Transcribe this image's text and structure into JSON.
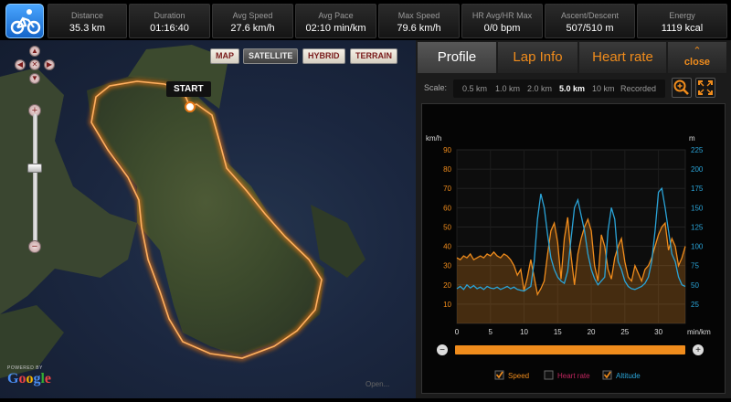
{
  "stats": [
    {
      "label": "Distance",
      "value": "35.3 km"
    },
    {
      "label": "Duration",
      "value": "01:16:40"
    },
    {
      "label": "Avg Speed",
      "value": "27.6 km/h"
    },
    {
      "label": "Avg Pace",
      "value": "02:10 min/km"
    },
    {
      "label": "Max Speed",
      "value": "79.6 km/h"
    },
    {
      "label": "HR Avg/HR Max",
      "value": "0/0 bpm"
    },
    {
      "label": "Ascent/Descent",
      "value": "507/510 m"
    },
    {
      "label": "Energy",
      "value": "1119 kcal"
    }
  ],
  "map": {
    "types": [
      "MAP",
      "SATELLITE",
      "HYBRID",
      "TERRAIN"
    ],
    "active_type": "SATELLITE",
    "start_label": "START",
    "nav": {
      "up": "▲",
      "down": "▼",
      "left": "◀",
      "right": "▶",
      "center": "✕"
    },
    "zoom": {
      "plus": "+",
      "minus": "−"
    },
    "attribution": {
      "powered_by": "POWERED BY",
      "logo": "Google"
    },
    "credit": "Open..."
  },
  "panel": {
    "tabs": [
      "Profile",
      "Lap Info",
      "Heart rate"
    ],
    "active_tab": "Profile",
    "close": {
      "chevron": "⌃",
      "label": "close"
    },
    "scale": {
      "label": "Scale:",
      "options": [
        "0.5 km",
        "1.0 km",
        "2.0 km",
        "5.0 km",
        "10 km",
        "Recorded"
      ],
      "selected": "5.0 km"
    },
    "icons": [
      "zoom-in-icon",
      "expand-icon"
    ]
  },
  "chart_data": {
    "type": "line",
    "x_unit": "min/km",
    "left_unit": "km/h",
    "right_unit": "m",
    "x_range": [
      0,
      34
    ],
    "x_ticks": [
      0,
      5,
      10,
      15,
      20,
      25,
      30
    ],
    "left_range": [
      0,
      90
    ],
    "left_ticks": [
      10,
      20,
      30,
      40,
      50,
      60,
      70,
      80,
      90
    ],
    "right_range": [
      0,
      225
    ],
    "right_ticks": [
      25,
      50,
      75,
      100,
      125,
      150,
      175,
      200,
      225
    ],
    "series": [
      {
        "name": "Speed",
        "axis": "left",
        "color": "#f08c1c",
        "enabled": true,
        "x": [
          0,
          0.5,
          1,
          1.5,
          2,
          2.5,
          3,
          3.5,
          4,
          4.5,
          5,
          5.5,
          6,
          6.5,
          7,
          7.5,
          8,
          8.5,
          9,
          9.5,
          10,
          10.5,
          11,
          11.5,
          12,
          12.5,
          13,
          13.5,
          14,
          14.5,
          15,
          15.5,
          16,
          16.5,
          17,
          17.5,
          18,
          18.5,
          19,
          19.5,
          20,
          20.5,
          21,
          21.5,
          22,
          22.5,
          23,
          23.5,
          24,
          24.5,
          25,
          25.5,
          26,
          26.5,
          27,
          27.5,
          28,
          28.5,
          29,
          29.5,
          30,
          30.5,
          31,
          31.5,
          32,
          32.5,
          33,
          33.5,
          34
        ],
        "values": [
          34,
          33,
          35,
          34,
          36,
          33,
          34,
          35,
          34,
          36,
          35,
          37,
          35,
          34,
          36,
          35,
          33,
          30,
          25,
          28,
          17,
          24,
          33,
          24,
          15,
          18,
          22,
          36,
          48,
          52,
          42,
          23,
          44,
          55,
          35,
          20,
          36,
          44,
          50,
          54,
          48,
          30,
          22,
          46,
          40,
          28,
          23,
          34,
          40,
          44,
          32,
          24,
          22,
          30,
          26,
          22,
          28,
          30,
          34,
          40,
          46,
          50,
          52,
          38,
          44,
          40,
          30,
          34,
          40
        ]
      },
      {
        "name": "Heart rate",
        "axis": "left",
        "color": "#c0265f",
        "enabled": false
      },
      {
        "name": "Altitude",
        "axis": "right",
        "color": "#2aa4d8",
        "enabled": true,
        "x": [
          0,
          0.5,
          1,
          1.5,
          2,
          2.5,
          3,
          3.5,
          4,
          4.5,
          5,
          5.5,
          6,
          6.5,
          7,
          7.5,
          8,
          8.5,
          9,
          9.5,
          10,
          10.5,
          11,
          11.5,
          12,
          12.5,
          13,
          13.5,
          14,
          14.5,
          15,
          15.5,
          16,
          16.5,
          17,
          17.5,
          18,
          18.5,
          19,
          19.5,
          20,
          20.5,
          21,
          21.5,
          22,
          22.5,
          23,
          23.5,
          24,
          24.5,
          25,
          25.5,
          26,
          26.5,
          27,
          27.5,
          28,
          28.5,
          29,
          29.5,
          30,
          30.5,
          31,
          31.5,
          32,
          32.5,
          33,
          33.5,
          34
        ],
        "values": [
          45,
          48,
          44,
          50,
          46,
          49,
          45,
          47,
          44,
          48,
          46,
          45,
          47,
          44,
          46,
          48,
          45,
          47,
          44,
          43,
          42,
          45,
          48,
          80,
          135,
          168,
          150,
          115,
          85,
          70,
          60,
          55,
          52,
          68,
          110,
          150,
          160,
          140,
          120,
          90,
          70,
          58,
          50,
          55,
          60,
          120,
          150,
          135,
          80,
          70,
          55,
          48,
          45,
          44,
          46,
          48,
          52,
          60,
          80,
          120,
          170,
          175,
          150,
          120,
          90,
          80,
          60,
          50,
          48
        ]
      }
    ],
    "legend": [
      "Speed",
      "Heart rate",
      "Altitude"
    ]
  }
}
